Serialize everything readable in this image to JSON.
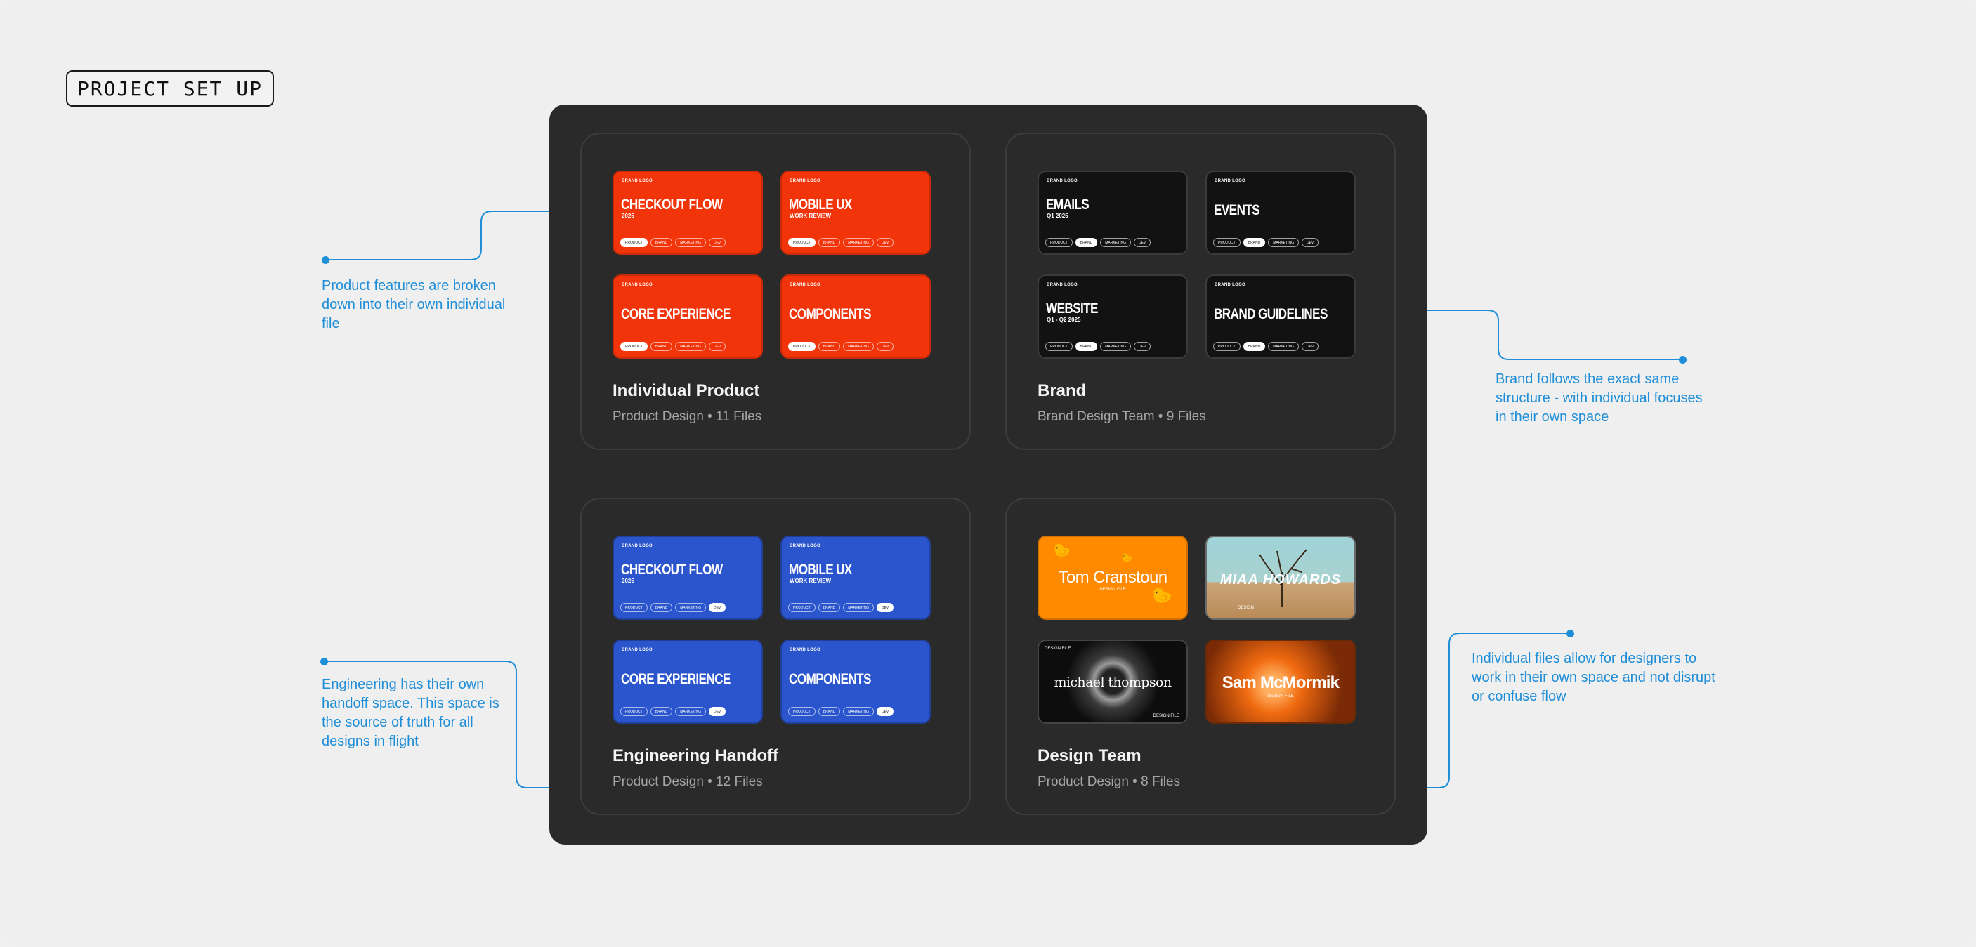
{
  "page_title": "PROJECT SET UP",
  "brand_logo": "BRAND LOGO",
  "tag_labels": [
    "PRODUCT",
    "BRAND",
    "MARKETING",
    "DEV"
  ],
  "panels": {
    "individual_product": {
      "title": "Individual Product",
      "subtitle": "Product Design • 11 Files",
      "cards": [
        {
          "title": "CHECKOUT FLOW",
          "sub": "2025"
        },
        {
          "title": "MOBILE UX",
          "sub": "WORK REVIEW"
        },
        {
          "title": "CORE EXPERIENCE",
          "sub": ""
        },
        {
          "title": "COMPONENTS",
          "sub": ""
        }
      ]
    },
    "brand": {
      "title": "Brand",
      "subtitle": "Brand Design Team • 9 Files",
      "cards": [
        {
          "title": "EMAILS",
          "sub": "Q1 2025"
        },
        {
          "title": "EVENTS",
          "sub": ""
        },
        {
          "title": "WEBSITE",
          "sub": "Q1 - Q2 2025"
        },
        {
          "title": "BRAND GUIDELINES",
          "sub": ""
        }
      ]
    },
    "engineering": {
      "title": "Engineering Handoff",
      "subtitle": "Product Design • 12 Files",
      "cards": [
        {
          "title": "CHECKOUT FLOW",
          "sub": "2025"
        },
        {
          "title": "MOBILE UX",
          "sub": "WORK REVIEW"
        },
        {
          "title": "CORE EXPERIENCE",
          "sub": ""
        },
        {
          "title": "COMPONENTS",
          "sub": ""
        }
      ]
    },
    "design_team": {
      "title": "Design Team",
      "subtitle": "Product Design • 8 Files",
      "cards": [
        {
          "name": "Tom Cranstoun",
          "sub": "DESIGN FILE"
        },
        {
          "name": "MIAA HOWARDS",
          "sub": "DESIGN"
        },
        {
          "name": "michael thompson",
          "sub": "DESIGN FILE"
        },
        {
          "name": "Sam McMormik",
          "sub": "DESIGN FILE"
        }
      ]
    }
  },
  "annotations": {
    "product": "Product features are broken down into their own individual file",
    "brand": "Brand follows the exact same structure - with individual focuses in their own space",
    "engineering": "Engineering has their own handoff space. This space is the source of truth for all designs in flight",
    "design": "Individual files allow for designers to work in their own space and not disrupt or confuse flow"
  },
  "colors": {
    "accent": "#1f8ed8",
    "product_card": "#f2340b",
    "brand_card": "#121212",
    "engineering_card": "#2b55cc",
    "board": "#2a2a2a"
  }
}
